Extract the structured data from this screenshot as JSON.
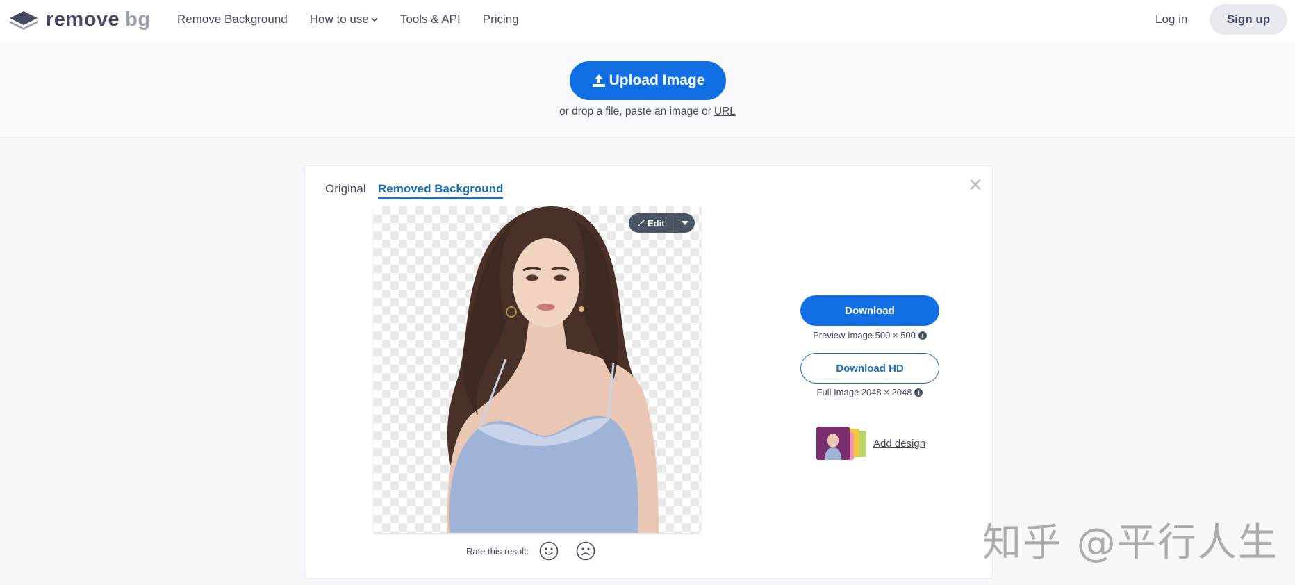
{
  "header": {
    "logo": {
      "word1": "remove",
      "word2": "bg"
    },
    "nav": [
      {
        "label": "Remove Background"
      },
      {
        "label": "How to use"
      },
      {
        "label": "Tools & API"
      },
      {
        "label": "Pricing"
      }
    ],
    "login_label": "Log in",
    "signup_label": "Sign up"
  },
  "upload": {
    "button_label": "Upload Image",
    "hint_text": "or drop a file, paste an image or",
    "hint_link": "URL"
  },
  "result": {
    "tabs": {
      "original": "Original",
      "removed": "Removed Background"
    },
    "edit_label": "Edit",
    "rate_label": "Rate this result:",
    "download_label": "Download",
    "preview_hint": "Preview Image 500 × 500",
    "download_hd_label": "Download HD",
    "full_hint": "Full Image 2048 × 2048",
    "add_design_label": "Add design"
  },
  "watermark": "知乎 @平行人生",
  "colors": {
    "accent": "#116fe3",
    "tab_active": "#1a6fbf",
    "text": "#454964"
  }
}
